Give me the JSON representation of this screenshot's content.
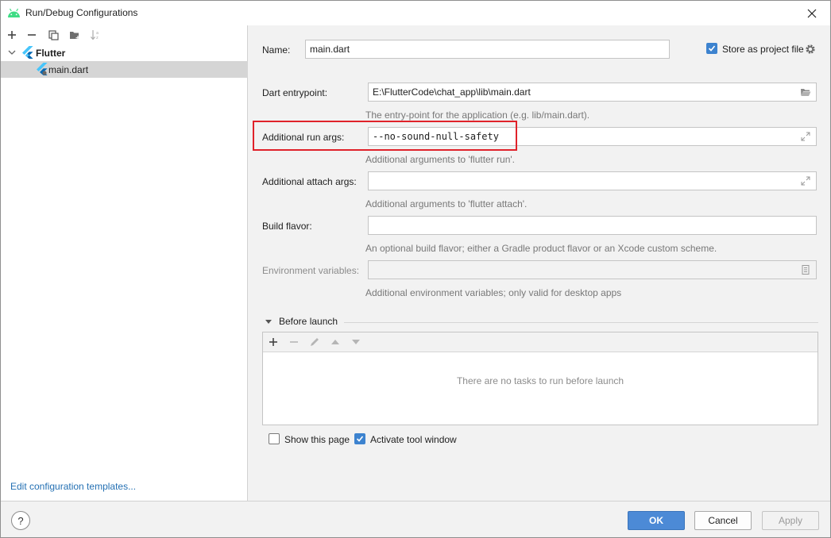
{
  "window": {
    "title": "Run/Debug Configurations",
    "accent_color": "#3d83cf",
    "highlight_color": "#e0222a"
  },
  "left_toolbar": {
    "icons": [
      "add-icon",
      "remove-icon",
      "copy-icon",
      "folder-add-icon",
      "sort-icon"
    ]
  },
  "tree": {
    "group_label": "Flutter",
    "item_label": "main.dart"
  },
  "edit_templates_link": "Edit configuration templates...",
  "form": {
    "name_label": "Name:",
    "name_value": "main.dart",
    "store_label": "Store as project file",
    "store_checked": true,
    "entrypoint_label": "Dart entrypoint:",
    "entrypoint_value": "E:\\FlutterCode\\chat_app\\lib\\main.dart",
    "entrypoint_hint": "The entry-point for the application (e.g. lib/main.dart).",
    "run_args_label": "Additional run args:",
    "run_args_value": "--no-sound-null-safety",
    "run_args_hint": "Additional arguments to 'flutter run'.",
    "attach_args_label": "Additional attach args:",
    "attach_args_value": "",
    "attach_args_hint": "Additional arguments to 'flutter attach'.",
    "build_flavor_label": "Build flavor:",
    "build_flavor_value": "",
    "build_flavor_hint": "An optional build flavor; either a Gradle product flavor or an Xcode custom scheme.",
    "env_label": "Environment variables:",
    "env_value": "",
    "env_hint": "Additional environment variables; only valid for desktop apps"
  },
  "before_launch": {
    "title": "Before launch",
    "empty_text": "There are no tasks to run before launch",
    "show_page_label": "Show this page",
    "show_page_checked": false,
    "activate_label": "Activate tool window",
    "activate_checked": true
  },
  "buttons": {
    "help": "?",
    "ok": "OK",
    "cancel": "Cancel",
    "apply": "Apply"
  }
}
